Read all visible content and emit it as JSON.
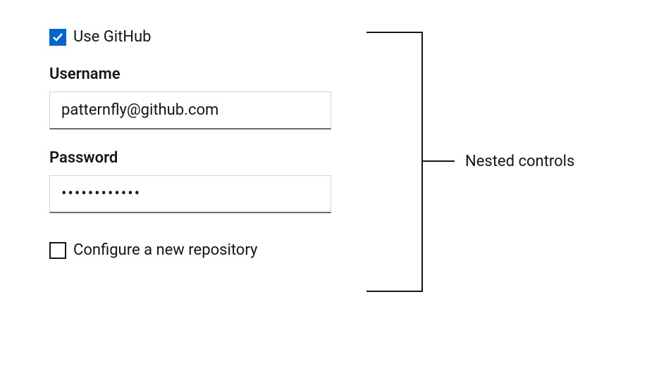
{
  "form": {
    "use_github": {
      "label": "Use GitHub",
      "checked": true
    },
    "username": {
      "label": "Username",
      "value": "patternfly@github.com"
    },
    "password": {
      "label": "Password",
      "value": "passwordword"
    },
    "configure_repo": {
      "label": "Configure a new repository",
      "checked": false
    }
  },
  "annotation": {
    "label": "Nested controls"
  }
}
